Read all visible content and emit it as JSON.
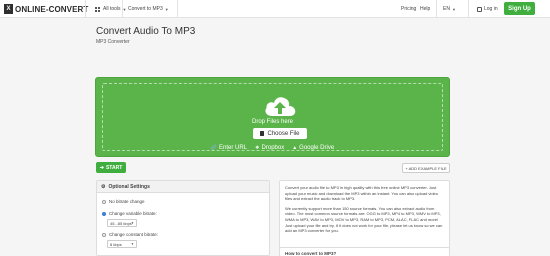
{
  "header": {
    "logo_text": "ONLINE-CONVERT",
    "all_tools": "All tools",
    "convert_to": "Convert to MP3",
    "pricing": "Pricing",
    "help": "Help",
    "language": "EN",
    "login": "Log in",
    "signup": "Sign Up"
  },
  "page": {
    "title": "Convert Audio To MP3",
    "subtitle": "MP3 Converter"
  },
  "upload": {
    "drop_text": "Drop Files here",
    "choose_file": "Choose File",
    "enter_url": "Enter URL",
    "dropbox": "Dropbox",
    "google_drive": "Google Drive"
  },
  "actions": {
    "start": "START",
    "add_example": "+ ADD EXAMPLE FILE"
  },
  "settings": {
    "heading": "Optional Settings",
    "no_bitrate": "No bitrate change",
    "variable_bitrate": "Change variable bitrate:",
    "variable_value": "45...85 kbps",
    "constant_bitrate": "Change constant bitrate:",
    "constant_value": "8 kbps"
  },
  "info": {
    "para1": "Convert your audio file to MP3 in high quality with this free online MP3 converter. Just upload your music and download the MP3 within an instant. You can also upload video files and extract the audio track to MP3.",
    "para2": "We currently support more than 150 source formats. You can also extract audio from video. The most common source formats are: OGG to MP3, MP4 to MP3, WMV to MP3, WMA to MP3, WAV to MP3, MOV to MP3, RAM to MP3, PCM, ALAC, FLAC and more! Just upload your file and try. If it does not work for your file, please let us know so we can add an MP3 converter for you.",
    "howto": "How to convert to MP3?"
  }
}
